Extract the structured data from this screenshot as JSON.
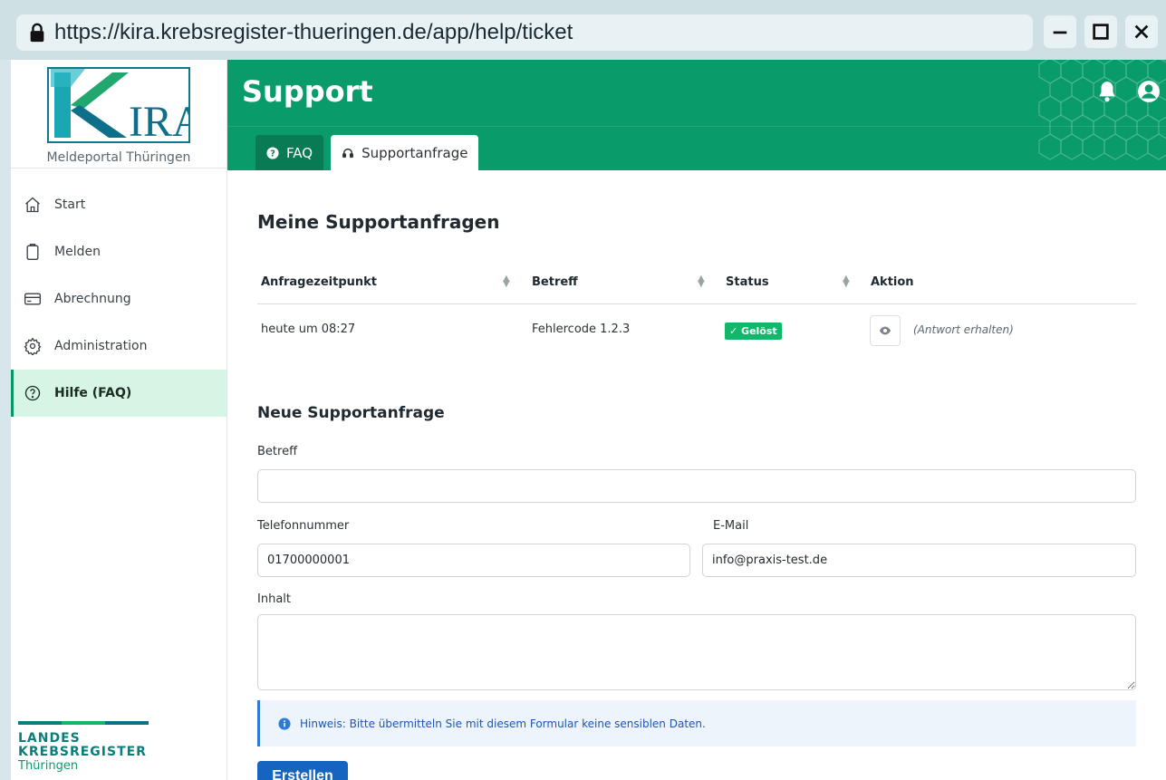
{
  "browser": {
    "url": "https://kira.krebsregister-thueringen.de/app/help/ticket"
  },
  "sidebar": {
    "logo_text": "KIRA",
    "subtitle": "Meldeportal Thüringen",
    "items": [
      {
        "label": "Start",
        "icon": "home-icon"
      },
      {
        "label": "Melden",
        "icon": "clipboard-icon"
      },
      {
        "label": "Abrechnung",
        "icon": "credit-card-icon"
      },
      {
        "label": "Administration",
        "icon": "gear-icon"
      },
      {
        "label": "Hilfe (FAQ)",
        "icon": "help-circle-icon",
        "active": true
      }
    ],
    "footer": {
      "line1": "LANDES",
      "line2": "KREBSREGISTER",
      "line3": "Thüringen"
    }
  },
  "header": {
    "title": "Support",
    "tabs": [
      {
        "label": "FAQ",
        "icon": "question-icon",
        "active": false
      },
      {
        "label": "Supportanfrage",
        "icon": "headset-icon",
        "active": true
      }
    ]
  },
  "main": {
    "title": "Meine Supportanfragen",
    "table": {
      "columns": [
        "Anfragezeitpunkt",
        "Betreff",
        "Status",
        "Aktion"
      ],
      "rows": [
        {
          "time": "heute um 08:27",
          "subject": "Fehlercode 1.2.3",
          "status": "✓ Gelöst",
          "action_note": "(Antwort erhalten)"
        }
      ]
    },
    "form": {
      "title": "Neue Supportanfrage",
      "subject_label": "Betreff",
      "subject_value": "",
      "phone_label": "Telefonnummer",
      "phone_value": "01700000001",
      "email_label": "E-Mail",
      "email_value": "info@praxis-test.de",
      "content_label": "Inhalt",
      "content_value": "",
      "hint": "Hinweis: Bitte übermitteln Sie mit diesem Formular keine sensiblen Daten.",
      "submit_label": "Erstellen"
    }
  },
  "colors": {
    "brand_green": "#0a9b6a",
    "active_bg": "#d6f5e5",
    "success": "#12b86a",
    "primary": "#1565c0"
  }
}
